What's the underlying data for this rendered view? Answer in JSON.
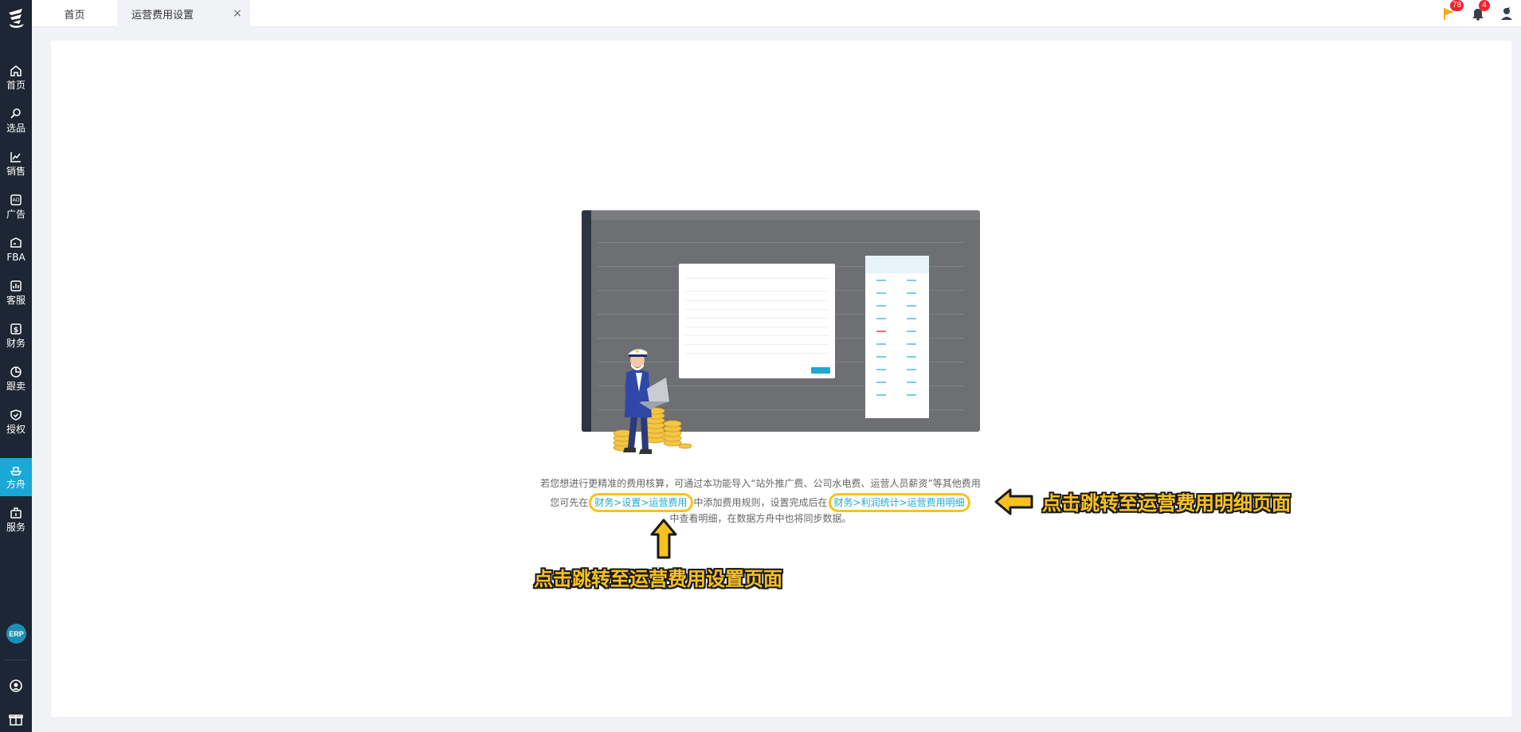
{
  "sidebar": {
    "items": [
      {
        "label": "首页",
        "icon": "home-icon"
      },
      {
        "label": "选品",
        "icon": "search-icon"
      },
      {
        "label": "销售",
        "icon": "chart-line-icon"
      },
      {
        "label": "广告",
        "icon": "ad-icon"
      },
      {
        "label": "FBA",
        "icon": "box-icon"
      },
      {
        "label": "客服",
        "icon": "bar-chart-icon"
      },
      {
        "label": "财务",
        "icon": "dollar-icon"
      },
      {
        "label": "跟卖",
        "icon": "pie-chart-icon"
      },
      {
        "label": "授权",
        "icon": "shield-icon"
      },
      {
        "label": "方舟",
        "icon": "ark-icon"
      },
      {
        "label": "服务",
        "icon": "briefcase-icon"
      }
    ],
    "active": "方舟",
    "erp_label": "ERP"
  },
  "tabs": {
    "home_label": "首页",
    "current_label": "运营费用设置",
    "close_glyph": "×"
  },
  "header": {
    "flag_count": "78",
    "bell_count": "4"
  },
  "main": {
    "desc_line1": "若您想进行更精准的费用核算，可通过本功能导入“站外推广费、公司水电费、运营人员薪资”等其他费用",
    "desc_prefix": "您可先在",
    "link_settings": "财务>设置>运营费用",
    "desc_middle": "中添加费用规则，设置完成后在",
    "link_detail": "财务>利润统计>运营费用明细",
    "desc_line3": "中查看明细，在数据方舟中也将同步数据。",
    "annotation_detail": "点击跳转至运营费用明细页面",
    "annotation_settings": "点击跳转至运营费用设置页面"
  },
  "colors": {
    "sidebar_bg": "#1c2634",
    "accent": "#1aa9d6",
    "highlight": "#f7c21f",
    "badge": "#f5222d"
  }
}
